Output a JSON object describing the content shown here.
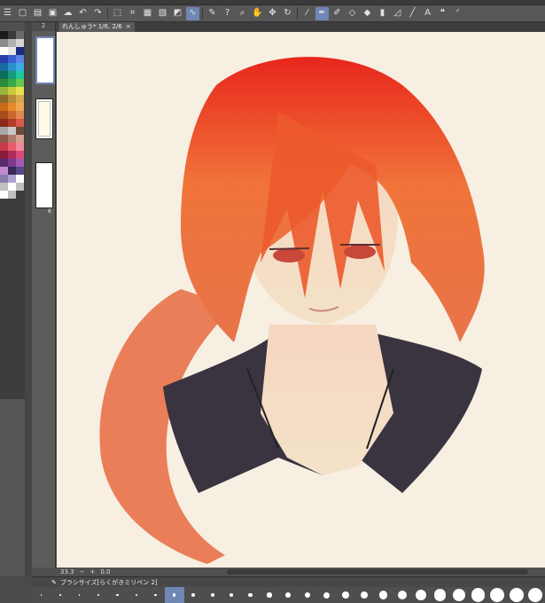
{
  "document_tab": {
    "title": "れんしゅう* 1/6, 2/6",
    "close_glyph": "×"
  },
  "page_panel": {
    "header": "2",
    "page_numbers": [
      "2",
      "",
      "6"
    ]
  },
  "status": {
    "zoom": "33.3",
    "angle": "0.0"
  },
  "brush": {
    "label": "ブラシサイズ[らくがきミリペン 2]"
  },
  "toolbar_icons": [
    "menu-icon",
    "new-file-icon",
    "open-icon",
    "save-icon",
    "cloud-icon",
    "undo-icon",
    "redo-icon",
    "transform-icon",
    "crop-icon",
    "select-all-icon",
    "deselect-icon",
    "invert-icon",
    "lasso-icon",
    "pen-icon",
    "help-icon",
    "zoom-icon",
    "hand-icon",
    "move-icon",
    "rotate-icon",
    "eyedropper-icon",
    "pen-tool-icon",
    "brush-icon",
    "eraser-icon",
    "fill-icon",
    "gradient-icon",
    "figure-icon",
    "ruler-icon",
    "text-icon",
    "balloon-icon",
    "correct-line-icon"
  ],
  "palette_colors": [
    "#1c1c1c",
    "#3b3b3b",
    "#6a6a6a",
    "#8a8a8a",
    "#b0b0b0",
    "#d6d6d6",
    "#ffffff",
    "#e8e8e8",
    "#1a2a7a",
    "#2a3fa8",
    "#3a5ed0",
    "#5b84e8",
    "#1a6aa0",
    "#2a90c8",
    "#3bb0e0",
    "#0d6b5a",
    "#139c7e",
    "#1ec8a0",
    "#2a8a3a",
    "#3aa848",
    "#6ac850",
    "#9ab53a",
    "#c8c83a",
    "#e8e050",
    "#8a6a2a",
    "#b88a3a",
    "#d8a850",
    "#c86a1a",
    "#e88a2a",
    "#f0a850",
    "#a84a1a",
    "#c8682a",
    "#e08a50",
    "#8a2a1a",
    "#b83a2a",
    "#d85a4a",
    "#a8a8a8",
    "#c8c8c8",
    "#6a4a3a",
    "#8a5a4a",
    "#b07a6a",
    "#d8a090",
    "#c83a4a",
    "#e85a6a",
    "#f08a9a",
    "#8a1a3a",
    "#b02a5a",
    "#d84a7a",
    "#5a2a6a",
    "#7a3a8a",
    "#a05ab0",
    "#c08ad0",
    "#3a2a5a",
    "#5a4a8a",
    "#8a7ab0",
    "#b0a0d0",
    "#ffffff",
    "#c0c0c0",
    "#ffffff",
    "#c0c0c0",
    "#ffffff",
    "#c0c0c0"
  ],
  "brush_sizes": [
    0.5,
    0.7,
    1,
    1.5,
    2,
    2.5,
    3,
    4,
    5,
    6,
    7,
    8,
    10,
    12,
    15,
    17,
    20,
    25,
    30,
    40,
    50,
    60,
    70,
    80,
    100,
    120,
    150
  ]
}
